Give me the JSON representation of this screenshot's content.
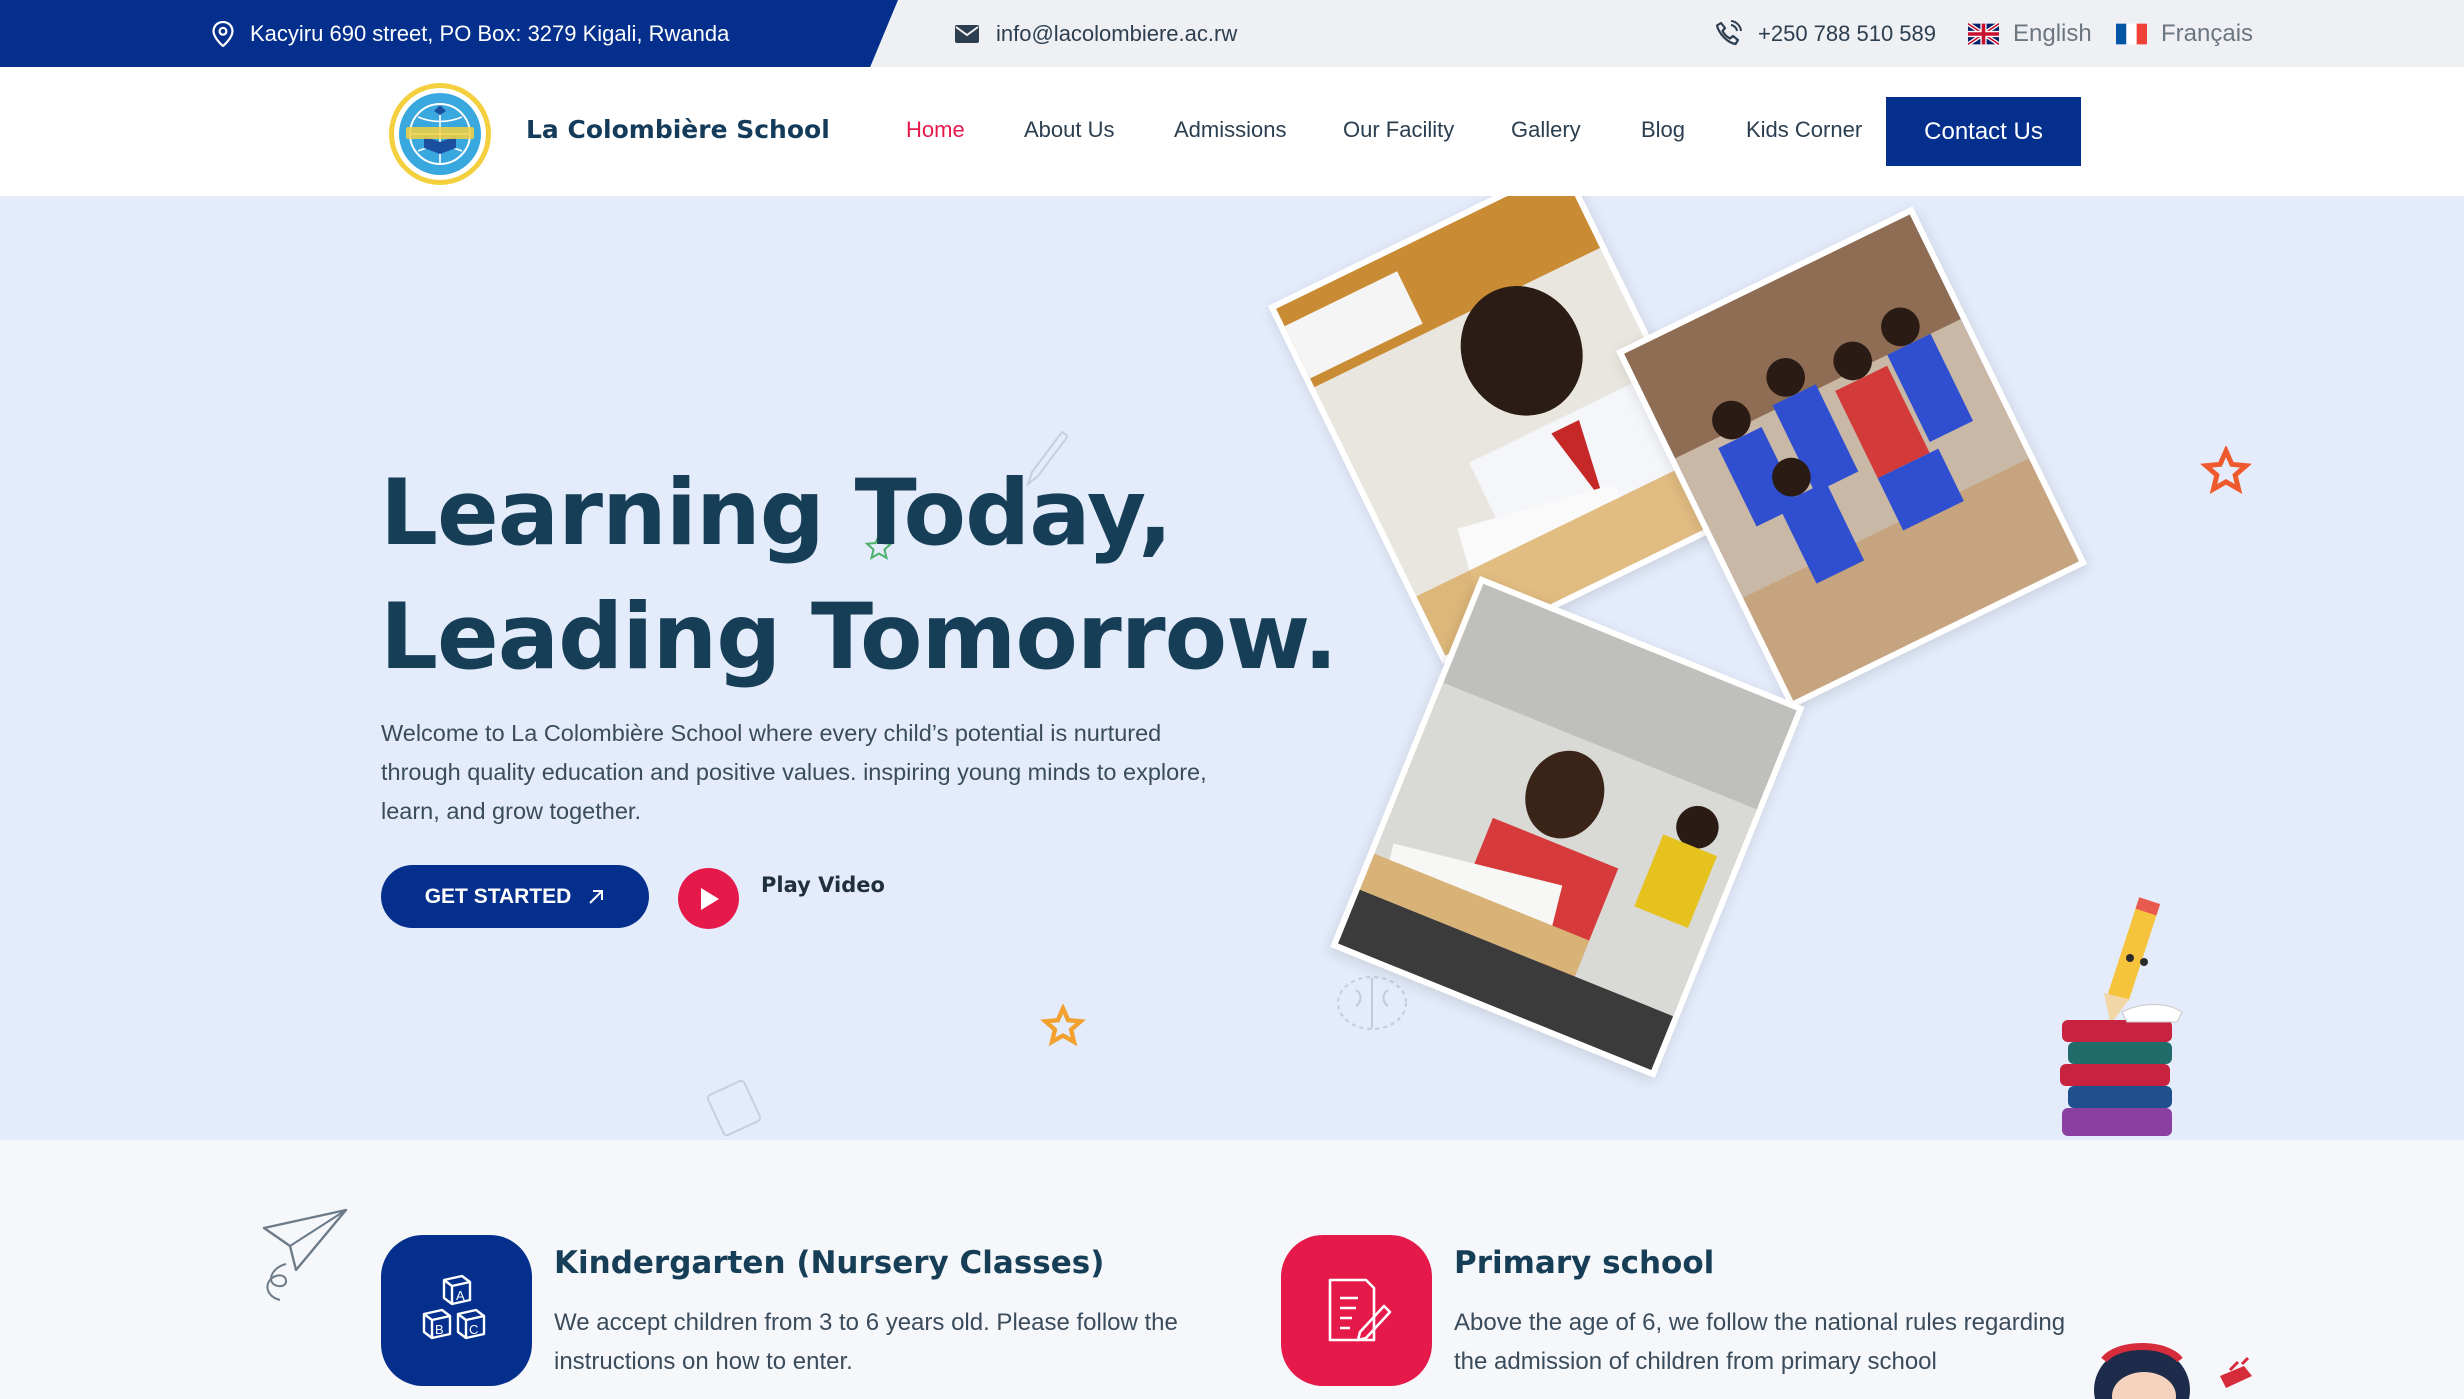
{
  "topbar": {
    "address": "Kacyiru 690 street, PO Box: 3279 Kigali, Rwanda",
    "email": "info@lacolombiere.ac.rw",
    "phone": "+250 788 510 589",
    "languages": [
      "English",
      "Français"
    ]
  },
  "nav": {
    "school_name": "La Colombière School",
    "links": [
      "Home",
      "About Us",
      "Admissions",
      "Our Facility",
      "Gallery",
      "Blog",
      "Kids Corner"
    ],
    "active": "Home",
    "contact_label": "Contact Us"
  },
  "hero": {
    "title_line1": "Learning Today,",
    "title_line2": "Leading Tomorrow.",
    "description": "Welcome to La Colombière School where every child’s potential is nurtured through quality education and positive values. inspiring young minds to explore, learn, and grow together.",
    "cta_label": "GET STARTED",
    "video_label": "Play Video"
  },
  "programs": [
    {
      "title": "Kindergarten (Nursery Classes)",
      "description": "We accept children from 3 to 6 years old. Please follow the instructions on how to enter.",
      "icon": "abc-blocks-icon",
      "color": "#042f8c"
    },
    {
      "title": "Primary school",
      "description": "Above the age of 6, we follow the national rules regarding the admission of children from primary school",
      "icon": "document-pencil-icon",
      "color": "#e51a4b"
    }
  ],
  "colors": {
    "primary": "#042f8c",
    "accent": "#e51a4b",
    "hero_bg": "#e4ecfb",
    "heading": "#173e57"
  }
}
